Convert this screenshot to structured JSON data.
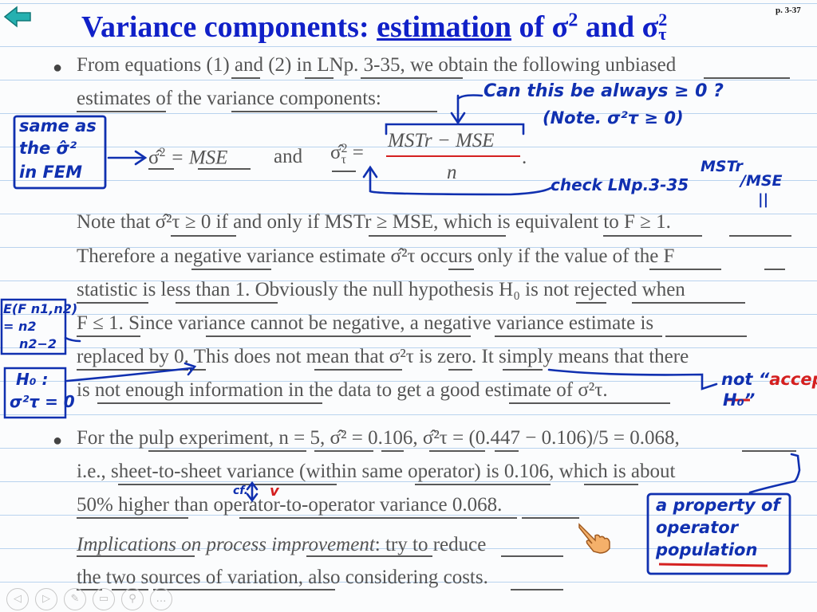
{
  "page_number": "p. 3-37",
  "title": {
    "part1": "Variance components: ",
    "part2": "estimation",
    "part3": " of σ",
    "sup1": "2",
    "part4": " and σ",
    "sup2": "2",
    "sub2": "τ"
  },
  "p1": {
    "line1": "From equations (1) and (2) in LNp. 3-35, we obtain the following unbiased",
    "line2": "estimates of the variance components:"
  },
  "formula": {
    "lhs1": "σ̂",
    "sup1": "2",
    "eq1": " = MSE",
    "and": "and",
    "lhs2": "σ̂",
    "sup2": "2",
    "sub2": "τ",
    "eq2": "=",
    "numerator": "MSTr − MSE",
    "denominator": "n",
    "period": "."
  },
  "p2": {
    "line1": "Note that σ̂²τ ≥ 0 if and only if MSTr ≥ MSE, which is equivalent to F ≥ 1.",
    "line2": "Therefore a negative variance estimate σ̂²τ occurs only if the value of the F",
    "line3": "statistic is less than 1. Obviously the null hypothesis H₀ is not rejected when",
    "line4": "F ≤ 1. Since variance cannot be negative, a negative variance estimate is",
    "line5": "replaced by 0. This does not mean that σ²τ is zero. It simply means that there",
    "line6": "is not enough information in the data to get a good estimate of σ²τ."
  },
  "p3": {
    "line1": "For the pulp experiment, n = 5, σ̂² = 0.106, σ̂²τ = (0.447 − 0.106)/5 = 0.068,",
    "line2": "i.e., sheet-to-sheet variance (within same operator) is 0.106, which is about",
    "line3": "50% higher than operator-to-operator variance 0.068.",
    "line4_italic": "Implications on process improvement",
    "line4_rest": ": try to reduce",
    "line5": "the two sources of variation, also considering costs."
  },
  "annotations": {
    "can_this": "Can this be always ≥ 0 ?",
    "note": "(Note. σ²τ ≥ 0)",
    "same_as": [
      "same as",
      "the σ̂²",
      "in FEM"
    ],
    "check": "check LNp.3-35",
    "mstr_ratio": [
      "MSTr",
      "/MSE",
      "||"
    ],
    "expect": [
      "E(F n1,n2)",
      "= n2",
      "n2−2"
    ],
    "h0": [
      "H₀ :",
      "σ²τ = 0"
    ],
    "not_accept_prefix": "not “",
    "not_accept_red": "accept",
    "h0_quote": "H₀”",
    "cf": "cf.",
    "v_mark": "v",
    "property": [
      "a property of",
      "operator",
      "population"
    ]
  },
  "colors": {
    "title": "#1020c8",
    "ink": "#1030b0",
    "red": "#d42020",
    "ruled_line": "#b9d3ee",
    "back_arrow": "#1aa0a0",
    "hand_cursor": "#f0a050"
  },
  "icons": [
    "back-arrow-icon",
    "hand-pointer-icon",
    "prev-icon",
    "next-icon",
    "pen-icon",
    "slides-icon",
    "zoom-icon",
    "more-icon"
  ]
}
